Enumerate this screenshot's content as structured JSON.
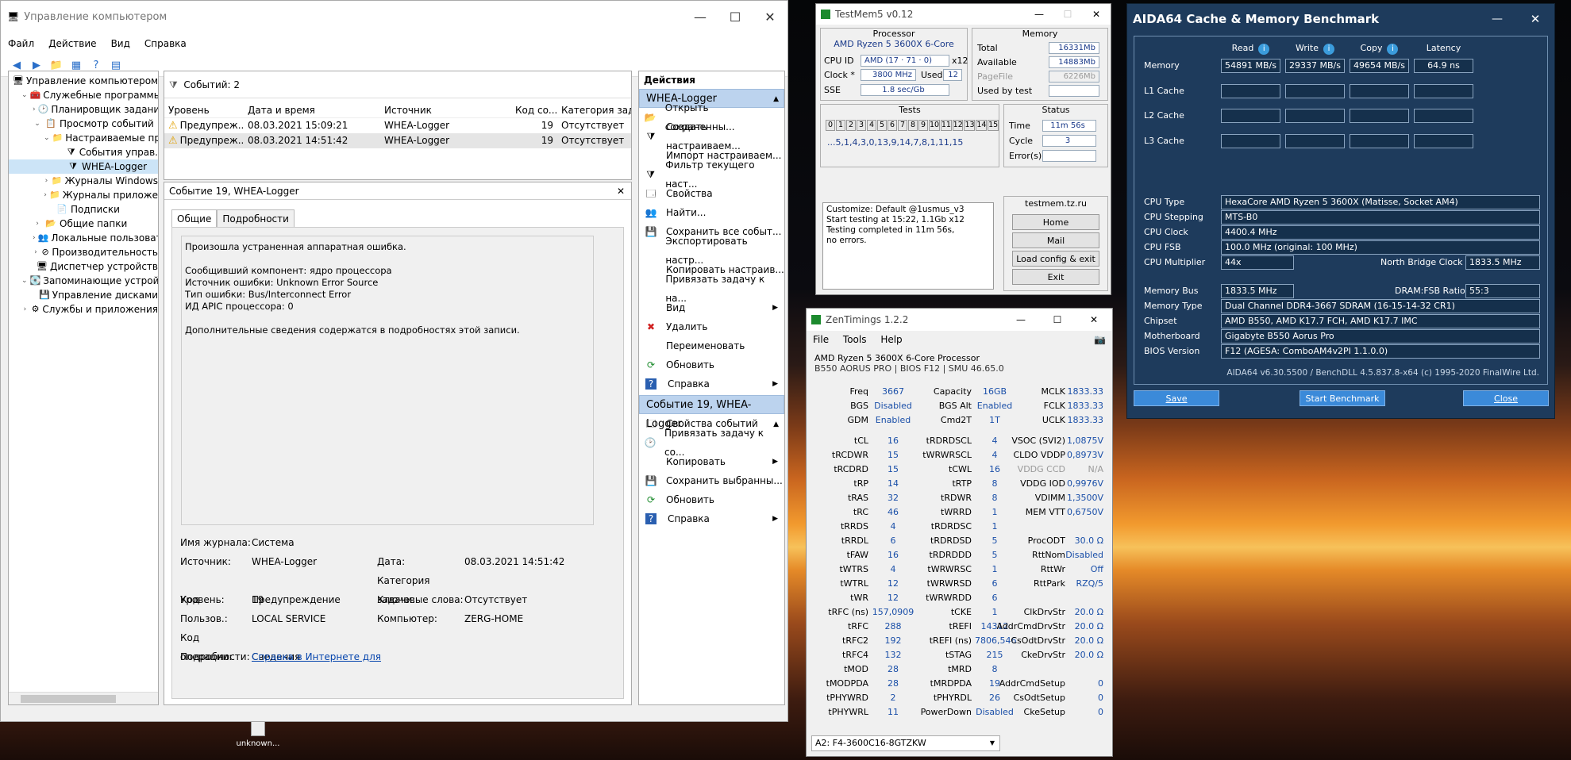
{
  "desktop": {
    "icon_label": "unknown..."
  },
  "mmc": {
    "title": "Управление компьютером",
    "menu": [
      "Файл",
      "Действие",
      "Вид",
      "Справка"
    ],
    "tree": [
      {
        "label": "Управление компьютером (л",
        "indent": 0,
        "arrow": "",
        "icon": "🖥"
      },
      {
        "label": "Служебные программы",
        "indent": 1,
        "arrow": "⌄",
        "icon": "🧰"
      },
      {
        "label": "Планировщик заданий",
        "indent": 2,
        "arrow": "›",
        "icon": "🕑"
      },
      {
        "label": "Просмотр событий",
        "indent": 2,
        "arrow": "⌄",
        "icon": "📋"
      },
      {
        "label": "Настраиваемые пр",
        "indent": 3,
        "arrow": "⌄",
        "icon": "📁"
      },
      {
        "label": "События управ.",
        "indent": 4,
        "arrow": "",
        "icon": "⧩"
      },
      {
        "label": "WHEA-Logger",
        "indent": 4,
        "arrow": "",
        "icon": "⧩"
      },
      {
        "label": "Журналы Windows",
        "indent": 3,
        "arrow": "›",
        "icon": "📁"
      },
      {
        "label": "Журналы приложе",
        "indent": 3,
        "arrow": "›",
        "icon": "📁"
      },
      {
        "label": "Подписки",
        "indent": 3,
        "arrow": "",
        "icon": "📄"
      },
      {
        "label": "Общие папки",
        "indent": 2,
        "arrow": "›",
        "icon": "📂"
      },
      {
        "label": "Локальные пользовате",
        "indent": 2,
        "arrow": "›",
        "icon": "👥"
      },
      {
        "label": "Производительность",
        "indent": 2,
        "arrow": "›",
        "icon": "⊘"
      },
      {
        "label": "Диспетчер устройств",
        "indent": 2,
        "arrow": "",
        "icon": "🖥"
      },
      {
        "label": "Запоминающие устройст",
        "indent": 1,
        "arrow": "⌄",
        "icon": "💽"
      },
      {
        "label": "Управление дисками",
        "indent": 2,
        "arrow": "",
        "icon": "💾"
      },
      {
        "label": "Службы и приложения",
        "indent": 1,
        "arrow": "›",
        "icon": "⚙"
      }
    ],
    "events_header": "Событий: 2",
    "columns": [
      "Уровень",
      "Дата и время",
      "Источник",
      "Код со...",
      "Категория задачи"
    ],
    "events": [
      {
        "level": "Предупреж...",
        "date": "08.03.2021 15:09:21",
        "source": "WHEA-Logger",
        "code": "19",
        "category": "Отсутствует"
      },
      {
        "level": "Предупреж...",
        "date": "08.03.2021 14:51:42",
        "source": "WHEA-Logger",
        "code": "19",
        "category": "Отсутствует"
      }
    ],
    "detail_title": "Событие 19, WHEA-Logger",
    "tabs": [
      "Общие",
      "Подробности"
    ],
    "message": [
      "Произошла устраненная аппаратная ошибка.",
      "",
      "Сообщивший компонент: ядро процессора",
      "Источник ошибки: Unknown Error Source",
      "Тип ошибки: Bus/Interconnect Error",
      "ИД APIC процессора: 0",
      "",
      "Дополнительные сведения содержатся в подробностях этой записи."
    ],
    "fields": {
      "log_name_label": "Имя журнала:",
      "log_name": "Система",
      "source_label": "Источник:",
      "source": "WHEA-Logger",
      "date_label": "Дата:",
      "date": "08.03.2021 14:51:42",
      "code_label": "Код",
      "code": "19",
      "category_label": "Категория задачи:",
      "category": "Отсутствует",
      "level_label": "Уровень:",
      "level": "Предупреждение",
      "keywords_label": "Ключевые слова:",
      "user_label": "Пользов.:",
      "user": "LOCAL SERVICE",
      "computer_label": "Компьютер:",
      "computer": "ZERG-HOME",
      "opcode_label": "Код операции:",
      "opcode": "Сведения",
      "more_label": "Подробности:",
      "more_link": "Справка в Интернете для"
    },
    "actions_title": "Действия",
    "actions_group1": "WHEA-Logger",
    "actions1": [
      {
        "label": "Открыть сохраненны...",
        "icon": "📂",
        "sub": false
      },
      {
        "label": "Создать настраиваем...",
        "icon": "⧩",
        "sub": false
      },
      {
        "label": "Импорт настраиваем...",
        "icon": "",
        "sub": false
      },
      {
        "label": "Фильтр текущего наст...",
        "icon": "⧩",
        "sub": false
      },
      {
        "label": "Свойства",
        "icon": "🗔",
        "sub": false
      },
      {
        "label": "Найти...",
        "icon": "👥",
        "sub": false
      },
      {
        "label": "Сохранить все событ...",
        "icon": "💾",
        "sub": false
      },
      {
        "label": "Экспортировать настр...",
        "icon": "",
        "sub": false
      },
      {
        "label": "Копировать настраив...",
        "icon": "",
        "sub": false
      },
      {
        "label": "Привязать задачу к на...",
        "icon": "",
        "sub": false
      },
      {
        "label": "Вид",
        "icon": "",
        "sub": true
      },
      {
        "label": "Удалить",
        "icon": "✖",
        "sub": false
      },
      {
        "label": "Переименовать",
        "icon": "",
        "sub": false
      },
      {
        "label": "Обновить",
        "icon": "⟳",
        "sub": false
      },
      {
        "label": "Справка",
        "icon": "?",
        "sub": true
      }
    ],
    "actions_group2": "Событие 19, WHEA-Logger",
    "actions2": [
      {
        "label": "Свойства событий",
        "icon": "🗔",
        "sub": false
      },
      {
        "label": "Привязать задачу к со...",
        "icon": "🕑",
        "sub": false
      },
      {
        "label": "Копировать",
        "icon": "",
        "sub": true
      },
      {
        "label": "Сохранить выбранны...",
        "icon": "💾",
        "sub": false
      },
      {
        "label": "Обновить",
        "icon": "⟳",
        "sub": false
      },
      {
        "label": "Справка",
        "icon": "?",
        "sub": true
      }
    ]
  },
  "testmem": {
    "title": "TestMem5 v0.12",
    "processor_header": "Processor",
    "cpu_name": "AMD Ryzen 5 3600X 6-Core",
    "cpu_id_label": "CPU ID",
    "cpu_id": "AMD  (17 · 71 · 0)",
    "cpu_threads": "x12",
    "clock_label": "Clock *",
    "clock": "3800 MHz",
    "used_label": "Used",
    "used": "12",
    "sse_label": "SSE",
    "sse": "1.8 sec/Gb",
    "memory_header": "Memory",
    "total_label": "Total",
    "total": "16331Mb",
    "available_label": "Available",
    "available": "14883Mb",
    "pagefile_label": "PageFile",
    "pagefile": "6226Mb",
    "usedbytest_label": "Used by test",
    "usedbytest": "",
    "tests_header": "Tests",
    "test_ids": [
      "0",
      "1",
      "2",
      "3",
      "4",
      "5",
      "6",
      "7",
      "8",
      "9",
      "10",
      "11",
      "12",
      "13",
      "14",
      "15"
    ],
    "test_seq": "...5,1,4,3,0,13,9,14,7,8,1,11,15",
    "status_header": "Status",
    "time_label": "Time",
    "time": "11m 56s",
    "cycle_label": "Cycle",
    "cycle": "3",
    "errors_label": "Error(s)",
    "errors": "",
    "log": [
      "Customize: Default @1usmus_v3",
      "Start testing at 15:22, 1.1Gb x12",
      "Testing completed in 11m 56s,",
      "no errors."
    ],
    "site": "testmem.tz.ru",
    "buttons": [
      "Home",
      "Mail",
      "Load config & exit",
      "Exit"
    ]
  },
  "zen": {
    "title": "ZenTimings 1.2.2",
    "menu": [
      "File",
      "Tools",
      "Help"
    ],
    "cpu": "AMD Ryzen 5 3600X 6-Core Processor",
    "board": "B550 AORUS PRO | BIOS F12 | SMU 46.65.0",
    "rows": [
      [
        "Freq",
        "3667",
        "Capacity",
        "16GB",
        "MCLK",
        "1833.33"
      ],
      [
        "BGS",
        "Disabled",
        "BGS Alt",
        "Enabled",
        "FCLK",
        "1833.33"
      ],
      [
        "GDM",
        "Enabled",
        "Cmd2T",
        "1T",
        "UCLK",
        "1833.33"
      ],
      [
        "tCL",
        "16",
        "tRDRDSCL",
        "4",
        "VSOC (SVI2)",
        "1,0875V"
      ],
      [
        "tRCDWR",
        "15",
        "tWRWRSCL",
        "4",
        "CLDO VDDP",
        "0,8973V"
      ],
      [
        "tRCDRD",
        "15",
        "tCWL",
        "16",
        "VDDG CCD",
        "N/A"
      ],
      [
        "tRP",
        "14",
        "tRTP",
        "8",
        "VDDG IOD",
        "0,9976V"
      ],
      [
        "tRAS",
        "32",
        "tRDWR",
        "8",
        "VDIMM",
        "1,3500V"
      ],
      [
        "tRC",
        "46",
        "tWRRD",
        "1",
        "MEM VTT",
        "0,6750V"
      ],
      [
        "tRRDS",
        "4",
        "tRDRDSC",
        "1",
        "",
        ""
      ],
      [
        "tRRDL",
        "6",
        "tRDRDSD",
        "5",
        "ProcODT",
        "30.0 Ω"
      ],
      [
        "tFAW",
        "16",
        "tRDRDDD",
        "5",
        "RttNom",
        "Disabled"
      ],
      [
        "tWTRS",
        "4",
        "tWRWRSC",
        "1",
        "RttWr",
        "Off"
      ],
      [
        "tWTRL",
        "12",
        "tWRWRSD",
        "6",
        "RttPark",
        "RZQ/5"
      ],
      [
        "tWR",
        "12",
        "tWRWRDD",
        "6",
        "",
        ""
      ],
      [
        "tRFC (ns)",
        "157,0909",
        "tCKE",
        "1",
        "ClkDrvStr",
        "20.0 Ω"
      ],
      [
        "tRFC",
        "288",
        "tREFI",
        "14312",
        "AddrCmdDrvStr",
        "20.0 Ω"
      ],
      [
        "tRFC2",
        "192",
        "tREFI (ns)",
        "7806,546",
        "CsOdtDrvStr",
        "20.0 Ω"
      ],
      [
        "tRFC4",
        "132",
        "tSTAG",
        "215",
        "CkeDrvStr",
        "20.0 Ω"
      ],
      [
        "tMOD",
        "28",
        "tMRD",
        "8",
        "",
        ""
      ],
      [
        "tMODPDA",
        "28",
        "tMRDPDA",
        "19",
        "AddrCmdSetup",
        "0"
      ],
      [
        "tPHYWRD",
        "2",
        "tPHYRDL",
        "26",
        "CsOdtSetup",
        "0"
      ],
      [
        "tPHYWRL",
        "11",
        "PowerDown",
        "Disabled",
        "CkeSetup",
        "0"
      ]
    ],
    "dimm": "A2: F4-3600C16-8GTZKW"
  },
  "aida": {
    "title": "AIDA64 Cache & Memory Benchmark",
    "cols": [
      "Read",
      "Write",
      "Copy",
      "Latency"
    ],
    "rows": [
      {
        "label": "Memory",
        "vals": [
          "54891 MB/s",
          "29337 MB/s",
          "49654 MB/s",
          "64.9 ns"
        ]
      },
      {
        "label": "L1 Cache",
        "vals": [
          "",
          "",
          "",
          ""
        ]
      },
      {
        "label": "L2 Cache",
        "vals": [
          "",
          "",
          "",
          ""
        ]
      },
      {
        "label": "L3 Cache",
        "vals": [
          "",
          "",
          "",
          ""
        ]
      }
    ],
    "cpu_type_label": "CPU Type",
    "cpu_type": "HexaCore AMD Ryzen 5 3600X  (Matisse, Socket AM4)",
    "cpu_stepping_label": "CPU Stepping",
    "cpu_stepping": "MTS-B0",
    "cpu_clock_label": "CPU Clock",
    "cpu_clock": "4400.4 MHz",
    "cpu_fsb_label": "CPU FSB",
    "cpu_fsb": "100.0 MHz  (original: 100 MHz)",
    "cpu_mult_label": "CPU Multiplier",
    "cpu_mult": "44x",
    "nb_clock_label": "North Bridge Clock",
    "nb_clock": "1833.5 MHz",
    "mem_bus_label": "Memory Bus",
    "mem_bus": "1833.5 MHz",
    "dram_ratio_label": "DRAM:FSB Ratio",
    "dram_ratio": "55:3",
    "mem_type_label": "Memory Type",
    "mem_type": "Dual Channel DDR4-3667 SDRAM  (16-15-14-32 CR1)",
    "chipset_label": "Chipset",
    "chipset": "AMD B550, AMD K17.7 FCH, AMD K17.7 IMC",
    "mobo_label": "Motherboard",
    "mobo": "Gigabyte B550 Aorus Pro",
    "bios_label": "BIOS Version",
    "bios": "F12  (AGESA: ComboAM4v2PI 1.1.0.0)",
    "footer": "AIDA64 v6.30.5500 / BenchDLL 4.5.837.8-x64  (c) 1995-2020 FinalWire Ltd.",
    "btn_save": "Save",
    "btn_start": "Start Benchmark",
    "btn_close": "Close"
  }
}
